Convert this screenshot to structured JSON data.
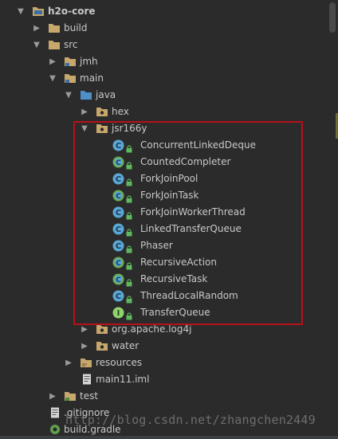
{
  "project_tree": {
    "root": "h2o-core",
    "build": "build",
    "src": "src",
    "jmh": "jmh",
    "main": "main",
    "java": "java",
    "hex": "hex",
    "jsr166y": "jsr166y",
    "classes": [
      {
        "name": "ConcurrentLinkedDeque",
        "kind": "class"
      },
      {
        "name": "CountedCompleter",
        "kind": "abstract-class"
      },
      {
        "name": "ForkJoinPool",
        "kind": "class"
      },
      {
        "name": "ForkJoinTask",
        "kind": "abstract-class"
      },
      {
        "name": "ForkJoinWorkerThread",
        "kind": "class"
      },
      {
        "name": "LinkedTransferQueue",
        "kind": "class"
      },
      {
        "name": "Phaser",
        "kind": "class"
      },
      {
        "name": "RecursiveAction",
        "kind": "abstract-class"
      },
      {
        "name": "RecursiveTask",
        "kind": "abstract-class"
      },
      {
        "name": "ThreadLocalRandom",
        "kind": "class"
      },
      {
        "name": "TransferQueue",
        "kind": "interface"
      }
    ],
    "log4j": "org.apache.log4j",
    "water": "water",
    "resources": "resources",
    "iml": "main11.iml",
    "test": "test",
    "gitignore": ".gitignore",
    "build_gradle": "build.gradle"
  },
  "watermark": "http://blog.csdn.net/zhangchen2449",
  "colors": {
    "background": "#2b2b2b",
    "text": "#c8c8c8",
    "folder": "#c7a76b",
    "class_badge": "#5aa8d6",
    "abstract_badge": "#6ab04c",
    "interface_badge": "#6ab04c",
    "highlight_border": "#b4121a",
    "lock": "#5fb75f"
  },
  "icons": {
    "expanded": "triangle-down",
    "collapsed": "triangle-right",
    "folder": "folder-icon",
    "package": "package-icon",
    "class": "class-icon",
    "lock": "lock-icon"
  }
}
